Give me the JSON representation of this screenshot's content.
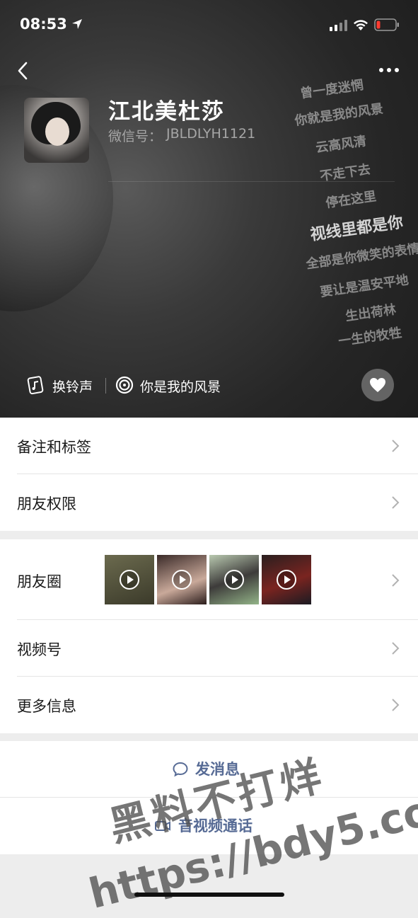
{
  "status_bar": {
    "time": "08:53"
  },
  "profile": {
    "name": "江北美杜莎",
    "wechat_id_label": "微信号：",
    "wechat_id": "JBLDLYH1121"
  },
  "background_lyrics": [
    "曾一度迷惘",
    "你就是我的风景",
    "云高风清",
    "不走下去",
    "停在这里",
    "视线里都是你",
    "全部是你微笑的表情",
    "要让是温安平地",
    "生出荷林",
    "一生的牧牲"
  ],
  "ringtone": {
    "change_label": "换铃声",
    "song": "你是我的风景"
  },
  "menu_group_1": [
    {
      "label": "备注和标签"
    },
    {
      "label": "朋友权限"
    }
  ],
  "menu_group_2": {
    "moments_label": "朋友圈",
    "items": [
      {
        "label": "视频号"
      },
      {
        "label": "更多信息"
      }
    ]
  },
  "actions": {
    "message": "发消息",
    "call": "音视频通话"
  },
  "watermark": {
    "line1": "黑料不打烊",
    "line2": "https://bdy5.co"
  },
  "colors": {
    "header_bg": "#2a2a2a",
    "link_blue": "#576b95",
    "page_bg": "#ededed"
  }
}
